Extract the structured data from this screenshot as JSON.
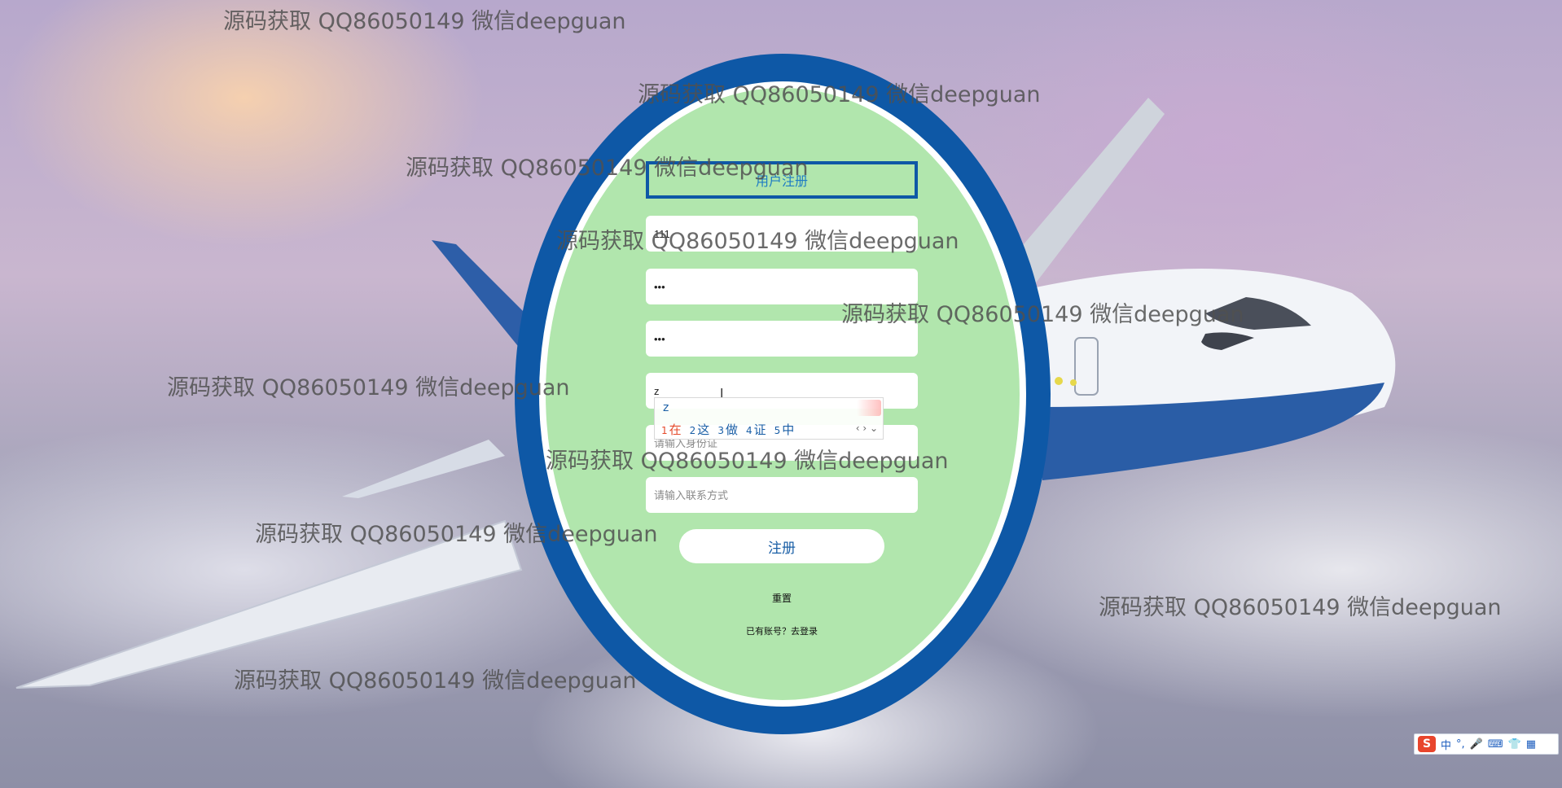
{
  "watermark": "源码获取 QQ86050149 微信deepguan",
  "form": {
    "title": "用户注册",
    "username_value": "111",
    "password_value": "•••",
    "confirm_password_value": "•••",
    "name_value": "z",
    "id_card_placeholder": "请输入身份证",
    "phone_placeholder": "请输入联系方式",
    "register_button": "注册",
    "reset_link": "重置",
    "login_link": "已有账号？去登录"
  },
  "ime": {
    "composition": "z",
    "candidates": [
      {
        "num": "1",
        "text": "在"
      },
      {
        "num": "2",
        "text": "这"
      },
      {
        "num": "3",
        "text": "做"
      },
      {
        "num": "4",
        "text": "证"
      },
      {
        "num": "5",
        "text": "中"
      }
    ],
    "nav": "‹ › ⌄"
  },
  "tray": {
    "logo": "S",
    "mode": "中",
    "punct": "°,",
    "icons": [
      "microphone-icon",
      "keyboard-icon",
      "shirt-icon",
      "grid-icon"
    ]
  },
  "colors": {
    "oval_blue": "#0e58a6",
    "oval_green": "#b1e6ad",
    "title_text": "#1d7bc4"
  }
}
